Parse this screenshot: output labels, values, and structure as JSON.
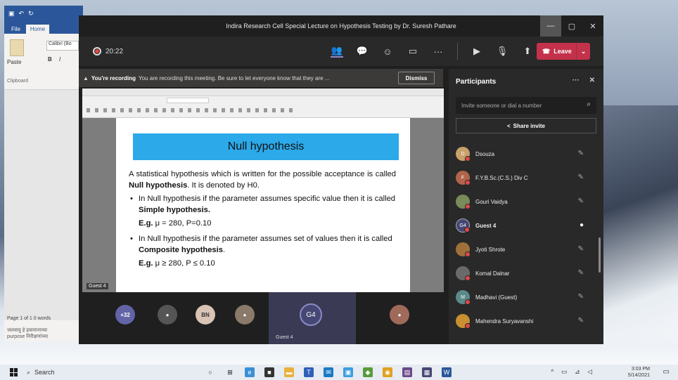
{
  "word": {
    "tabs": [
      "File",
      "Home"
    ],
    "font_box": "Calibri (Bo",
    "paste_label": "Paste",
    "clipboard_label": "Clipboard",
    "status": "Page 1 of 1   0 words",
    "lines": [
      "जलवायु   हे  हवामानाच्या",
      "purpose   निरीक्षणांच्या"
    ]
  },
  "teams": {
    "title": "Indira Research Cell Special Lecture on Hypothesis Testing by Dr. Suresh Pathare",
    "timer": "20:22",
    "leave_label": "Leave",
    "banner": {
      "bold": "You're recording",
      "text": "You are recording this meeting. Be sure to let everyone know that they are ...",
      "dismiss": "Dismiss"
    }
  },
  "slide": {
    "title": "Null hypothesis",
    "intro_pre": "A statistical hypothesis which is written for the possible acceptance is called ",
    "intro_bold": "Null hypothesis",
    "intro_post": ". It is denoted by H0.",
    "b1_pre": "In Null hypothesis if the parameter assumes specific value then it is called ",
    "b1_bold": "Simple hypothesis.",
    "eg1_bold": "E.g.",
    "eg1": " μ = 280, P=0.10",
    "b2_pre": "In Null hypothesis if the parameter assumes set of values then it is called ",
    "b2_bold": "Composite hypothesis",
    "b2_post": ".",
    "eg2_bold": "E.g.",
    "eg2": " μ ≥ 280, P ≤ 0.10",
    "speaker_tag": "Guest 4"
  },
  "panel": {
    "title": "Participants",
    "invite_placeholder": "Invite someone or dial a number",
    "share_invite": "Share invite",
    "participants": [
      {
        "name": "Dsouza",
        "initials": "D",
        "color": "#c8a06a"
      },
      {
        "name": "F.Y.B.Sc.(C.S.) Div C",
        "initials": "F",
        "color": "#b0654a"
      },
      {
        "name": "Gouri Vaidya",
        "initials": "",
        "color": "#7a8a5a"
      },
      {
        "name": "Guest 4",
        "initials": "G4",
        "color": "#464775"
      },
      {
        "name": "Jyoti Shrote",
        "initials": "",
        "color": "#a0703a"
      },
      {
        "name": "Komal Dalnar",
        "initials": "",
        "color": "#6a6a6a"
      },
      {
        "name": "Madhavi (Guest)",
        "initials": "M",
        "color": "#5b8a8a"
      },
      {
        "name": "Mahendra Suryavanshi",
        "initials": "",
        "color": "#c89030"
      }
    ]
  },
  "gallery": {
    "more_count": "+32",
    "bn": "BN",
    "g4": "G4",
    "g4_label": "Guest 4"
  },
  "taskbar": {
    "search": "Search",
    "time": "3:03 PM",
    "date": "5/14/2021"
  }
}
